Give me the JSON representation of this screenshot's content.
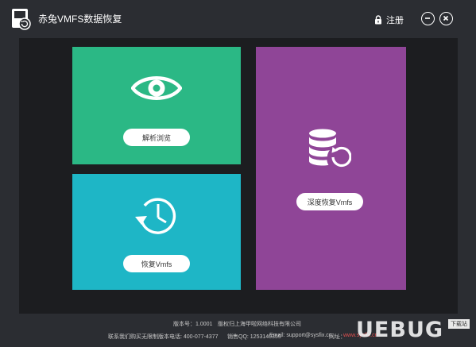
{
  "window": {
    "title": "赤兔VMFS数据恢复",
    "register_label": "注册",
    "logo_icon": "disk-restore-icon",
    "minimize_icon": "minus-circle-icon",
    "close_icon": "close-circle-icon"
  },
  "tiles": {
    "browse": {
      "label": "解析浏览",
      "icon": "eye-icon",
      "color": "#2bb885"
    },
    "restore": {
      "label": "恢复Vmfs",
      "icon": "clock-history-icon",
      "color": "#1eb6c6"
    },
    "deep": {
      "label": "深度恢复Vmfs",
      "icon": "database-restore-icon",
      "color": "#8f4597"
    }
  },
  "footer": {
    "version": "版本号：1.0001",
    "copyright": "版权归上海甲啦网络科技有限公司",
    "contact_hint": "联系我们购买无限制版本",
    "phone": "电话: 400-077-4377",
    "qq": "销售QQ: 1253140355",
    "email": "Email: support@sysfix.cn",
    "website_label": "网址：",
    "website": "www.sysfix.cn"
  },
  "watermark": {
    "text": "UEBUG",
    "tag": "下载站"
  },
  "colors": {
    "background": "#2b2d32",
    "content_bg": "#1c1d20",
    "browse_tile": "#2bb885",
    "restore_tile": "#1eb6c6",
    "deep_tile": "#8f4597"
  }
}
